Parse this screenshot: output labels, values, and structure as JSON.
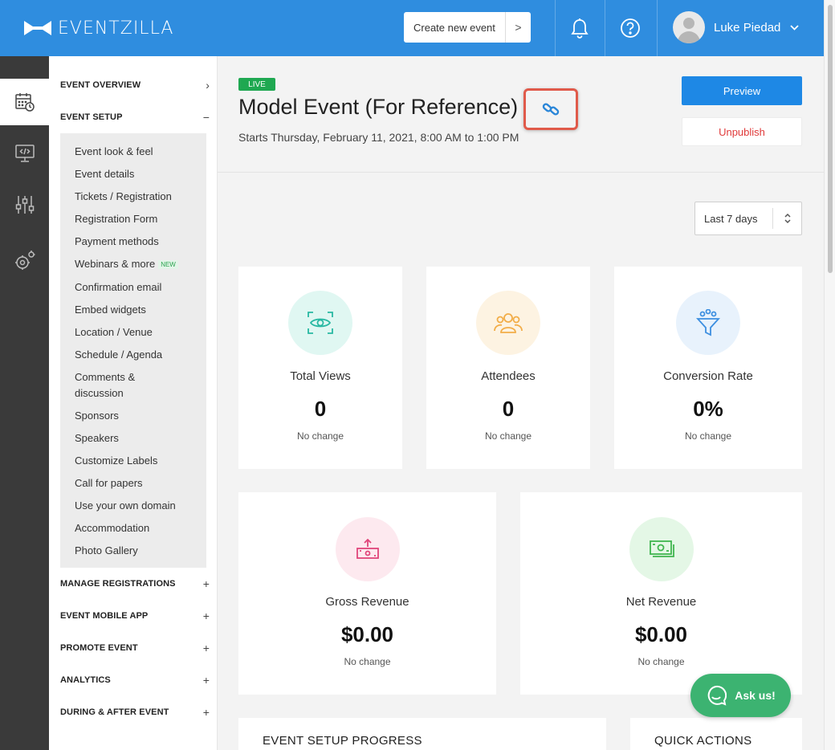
{
  "app": {
    "brand": "EVENTZILLA"
  },
  "topbar": {
    "create_label": "Create new event",
    "create_chevron": ">",
    "notifications_icon": "bell-icon",
    "help_icon": "question-circle-icon",
    "user_name": "Luke Piedad",
    "user_caret": "⌄"
  },
  "rail": {
    "icons": [
      "calendar-settings-icon",
      "monitor-code-icon",
      "sliders-icon",
      "gears-icon"
    ]
  },
  "sidebar": {
    "sections": [
      {
        "label": "EVENT OVERVIEW",
        "sign": "›"
      },
      {
        "label": "EVENT SETUP",
        "sign": "−"
      },
      {
        "label": "MANAGE REGISTRATIONS",
        "sign": "+"
      },
      {
        "label": "EVENT MOBILE APP",
        "sign": "+"
      },
      {
        "label": "PROMOTE EVENT",
        "sign": "+"
      },
      {
        "label": "ANALYTICS",
        "sign": "+"
      },
      {
        "label": "DURING & AFTER EVENT",
        "sign": "+"
      }
    ],
    "setup_items": [
      "Event look & feel",
      "Event details",
      "Tickets / Registration",
      "Registration Form",
      "Payment methods",
      "Webinars & more",
      "Confirmation email",
      "Embed widgets",
      "Location / Venue",
      "Schedule / Agenda",
      "Comments &",
      "discussion",
      "Sponsors",
      "Speakers",
      "Customize Labels",
      "Call for papers",
      "Use your own domain",
      "Accommodation",
      "Photo Gallery"
    ],
    "new_badge": "NEW"
  },
  "header": {
    "status": "LIVE",
    "title": "Model Event (For Reference)",
    "subtitle": "Starts Thursday, February 11, 2021, 8:00 AM to 1:00 PM",
    "preview_label": "Preview",
    "unpublish_label": "Unpublish"
  },
  "filter": {
    "range_label": "Last 7 days"
  },
  "stats": [
    {
      "label": "Total Views",
      "value": "0",
      "change": "No change",
      "icon": "eye-scan-icon",
      "color": "#e0f7f2"
    },
    {
      "label": "Attendees",
      "value": "0",
      "change": "No change",
      "icon": "people-icon",
      "color": "#fdf3e2"
    },
    {
      "label": "Conversion Rate",
      "value": "0%",
      "change": "No change",
      "icon": "funnel-icon",
      "color": "#e8f2fc"
    },
    {
      "label": "Gross Revenue",
      "value": "$0.00",
      "change": "No change",
      "icon": "money-up-icon",
      "color": "#fde9ef"
    },
    {
      "label": "Net Revenue",
      "value": "$0.00",
      "change": "No change",
      "icon": "money-bill-icon",
      "color": "#e4f7e6"
    }
  ],
  "chat": {
    "label": "Ask us!"
  },
  "panels": {
    "setup_progress": "EVENT SETUP PROGRESS",
    "quick_actions": "QUICK ACTIONS"
  }
}
